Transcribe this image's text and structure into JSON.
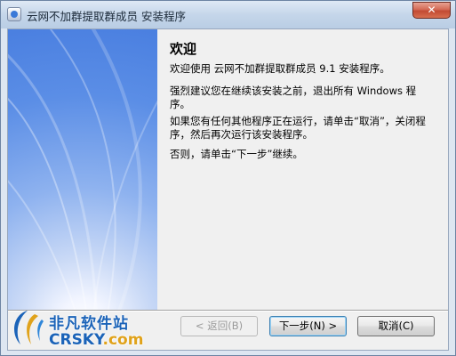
{
  "window": {
    "title": "云网不加群提取群成员 安装程序",
    "close_glyph": "✕"
  },
  "wizard": {
    "heading": "欢迎",
    "paragraphs": [
      "欢迎使用 云网不加群提取群成员 9.1 安装程序。",
      "强烈建议您在继续该安装之前，退出所有 Windows 程序。",
      "如果您有任何其他程序正在运行，请单击“取消”，关闭程序，然后再次运行该安装程序。",
      "否则，请单击“下一步”继续。"
    ]
  },
  "buttons": {
    "back": "< 返回(B)",
    "next": "下一步(N) >",
    "cancel": "取消(C)"
  },
  "watermark": {
    "cn": "非凡软件站",
    "en_main": "CRSKY",
    "en_suffix": ".com"
  }
}
